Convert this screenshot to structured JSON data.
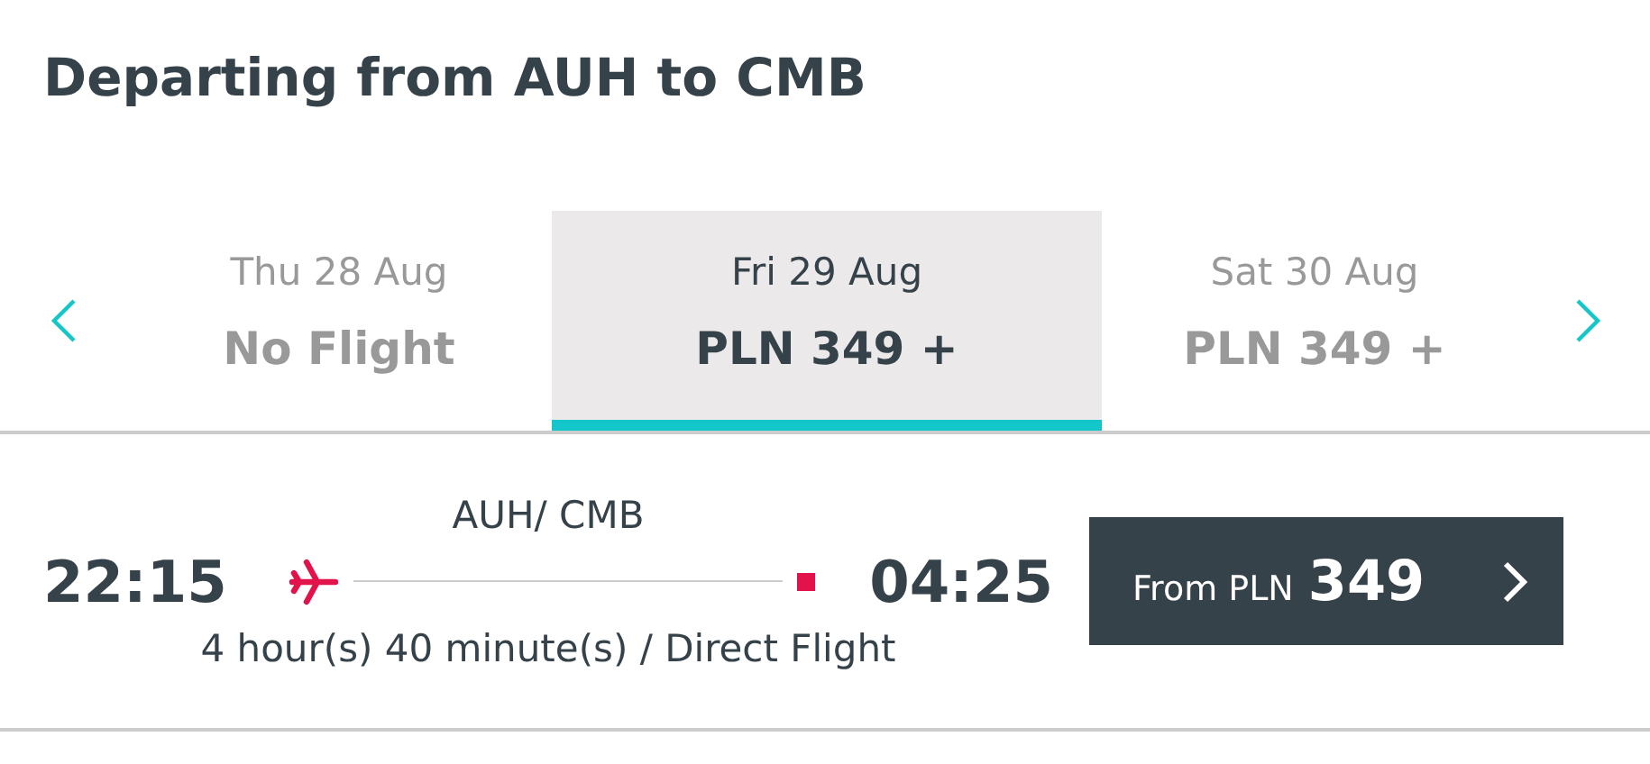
{
  "title": "Departing from AUH to CMB",
  "dates": [
    {
      "date": "Thu 28 Aug",
      "price": "No Flight",
      "selected": false
    },
    {
      "date": "Fri 29 Aug",
      "price": "PLN 349 +",
      "selected": true
    },
    {
      "date": "Sat 30 Aug",
      "price": "PLN 349 +",
      "selected": false
    }
  ],
  "flight": {
    "route": "AUH/ CMB",
    "depart": "22:15",
    "arrive": "04:25",
    "duration": "4 hour(s) 40 minute(s) / Direct Flight",
    "button": {
      "prefix": "From PLN",
      "amount": "349"
    }
  }
}
